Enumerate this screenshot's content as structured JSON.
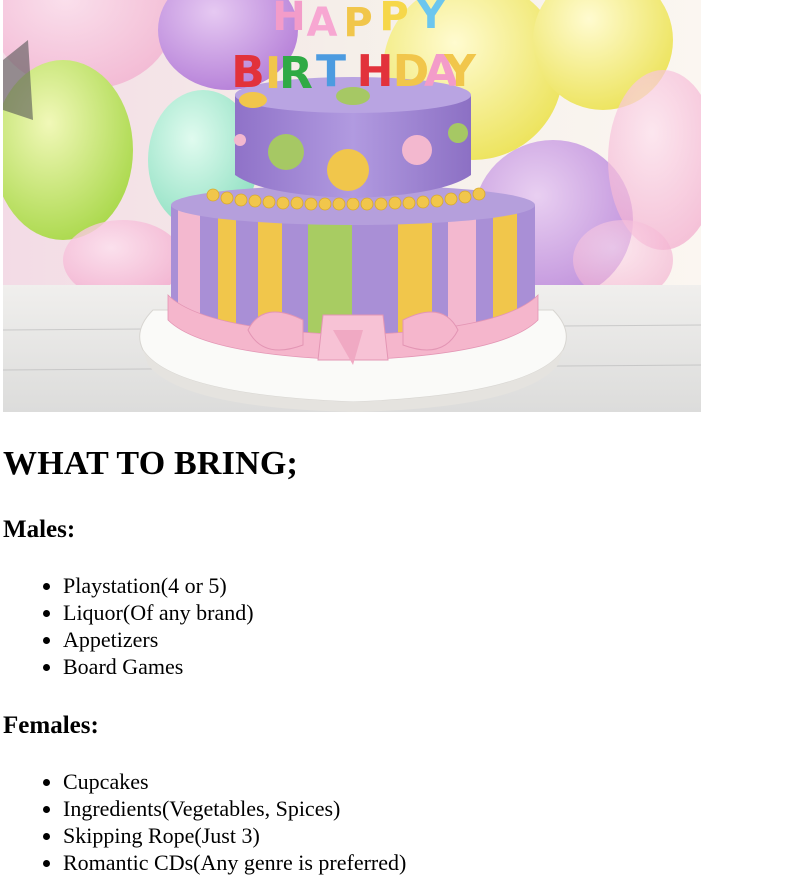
{
  "image": {
    "subject": "birthday cake with candles",
    "candle_letters_top": "HAPPY",
    "candle_letters_bottom": "BIRTHDAY"
  },
  "heading": "WHAT TO BRING;",
  "males": {
    "title": "Males:",
    "items": [
      "Playstation(4 or 5)",
      "Liquor(Of any brand)",
      "Appetizers",
      "Board Games"
    ]
  },
  "females": {
    "title": "Females:",
    "items": [
      "Cupcakes",
      "Ingredients(Vegetables, Spices)",
      "Skipping Rope(Just 3)",
      "Romantic CDs(Any genre is preferred)"
    ]
  },
  "colors": {
    "cake_purple": "#a98fd6",
    "stripe_yellow": "#f1c64b",
    "stripe_green": "#a8cc62",
    "stripe_pink": "#f3b8cf",
    "ribbon_pink": "#f5b6cc"
  }
}
